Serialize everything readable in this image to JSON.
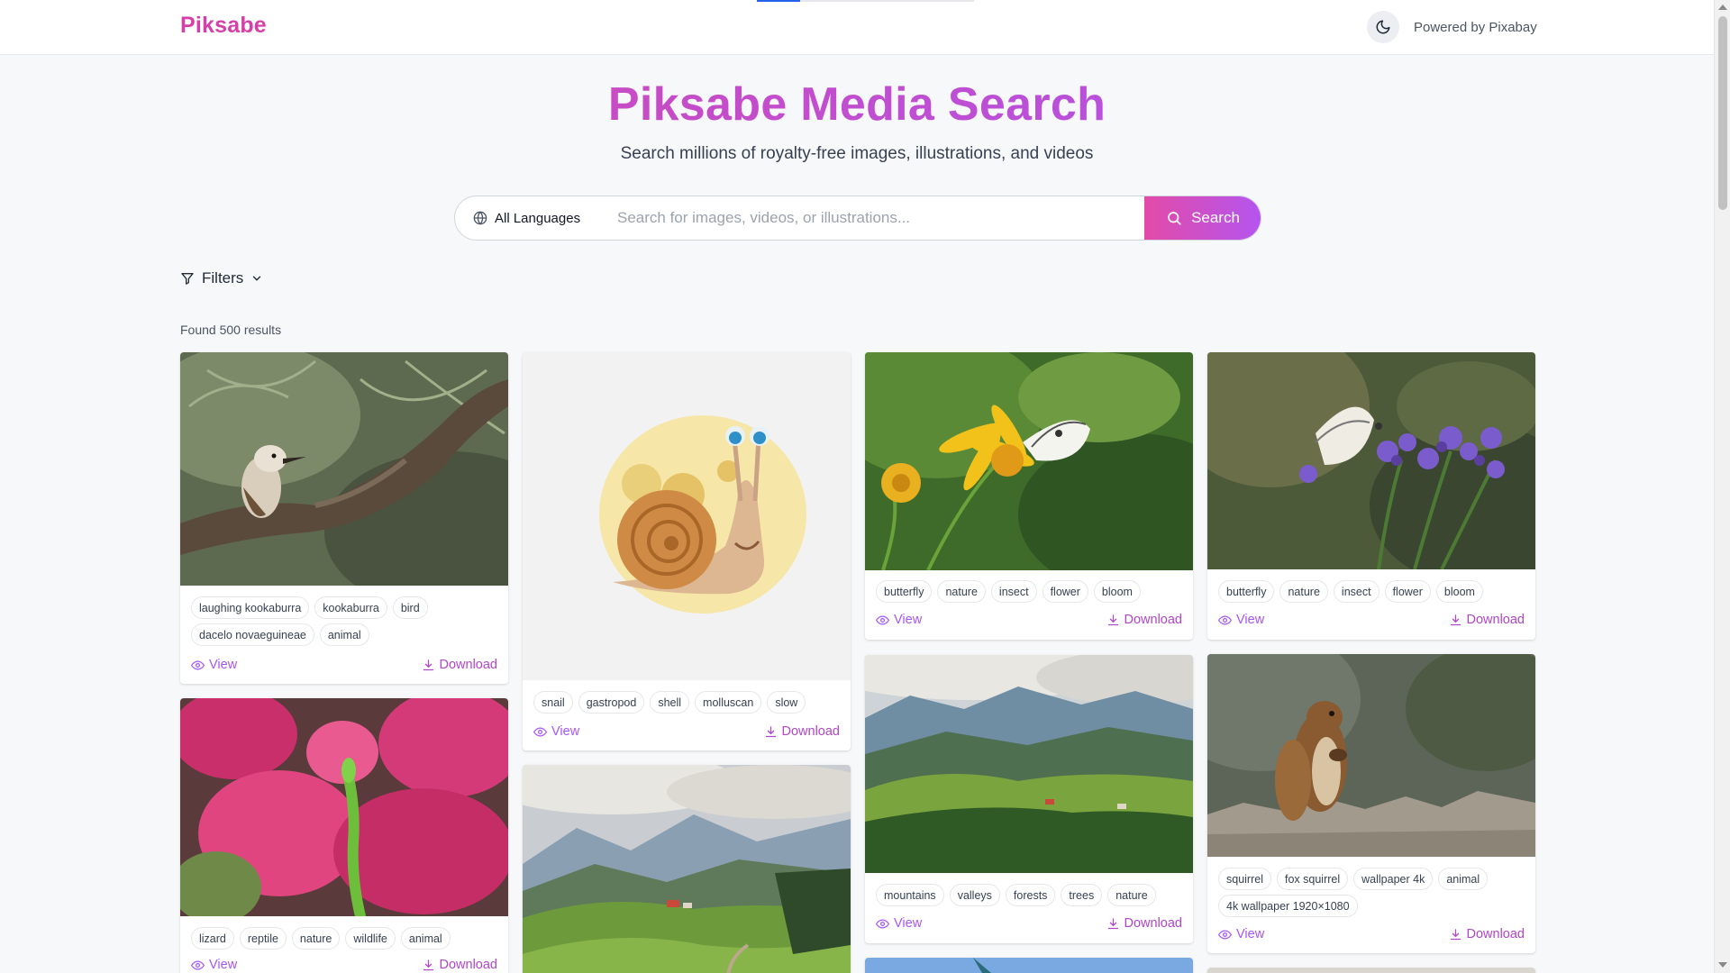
{
  "header": {
    "logo": "Piksabe",
    "powered_by": "Powered by Pixabay",
    "theme_toggle_icon": "moon-icon"
  },
  "hero": {
    "title": "Piksabe Media Search",
    "subtitle": "Search millions of royalty-free images, illustrations, and videos"
  },
  "search": {
    "language": "All Languages",
    "placeholder": "Search for images, videos, or illustrations...",
    "button_label": "Search"
  },
  "filters": {
    "label": "Filters"
  },
  "results": {
    "summary": "Found 500 results"
  },
  "labels": {
    "view": "View",
    "download": "Download"
  },
  "colors": {
    "brand": "#d63fa8",
    "accent": "#a855f7",
    "link": "#a855f7"
  },
  "cards": [
    {
      "image": "kookaburra on branch",
      "tags": [
        "laughing kookaburra",
        "kookaburra",
        "bird",
        "dacelo novaeguineae",
        "animal"
      ]
    },
    {
      "image": "lizard on pink flowers",
      "tags": [
        "lizard",
        "reptile",
        "nature",
        "wildlife",
        "animal"
      ]
    },
    {
      "image": "cartoon snail",
      "tags": [
        "snail",
        "gastropod",
        "shell",
        "molluscan",
        "slow"
      ]
    },
    {
      "image": "green hills landscape",
      "tags": []
    },
    {
      "image": "butterfly on yellow flower",
      "tags": [
        "butterfly",
        "nature",
        "insect",
        "flower",
        "bloom"
      ]
    },
    {
      "image": "mountain valley landscape",
      "tags": [
        "mountains",
        "valleys",
        "forests",
        "trees",
        "nature"
      ]
    },
    {
      "image": "butterfly on purple flower",
      "tags": [
        "butterfly",
        "nature",
        "insect",
        "flower",
        "bloom"
      ]
    },
    {
      "image": "squirrel on fence",
      "tags": [
        "squirrel",
        "fox squirrel",
        "wallpaper 4k",
        "animal",
        "4k wallpaper 1920×1080"
      ]
    }
  ]
}
